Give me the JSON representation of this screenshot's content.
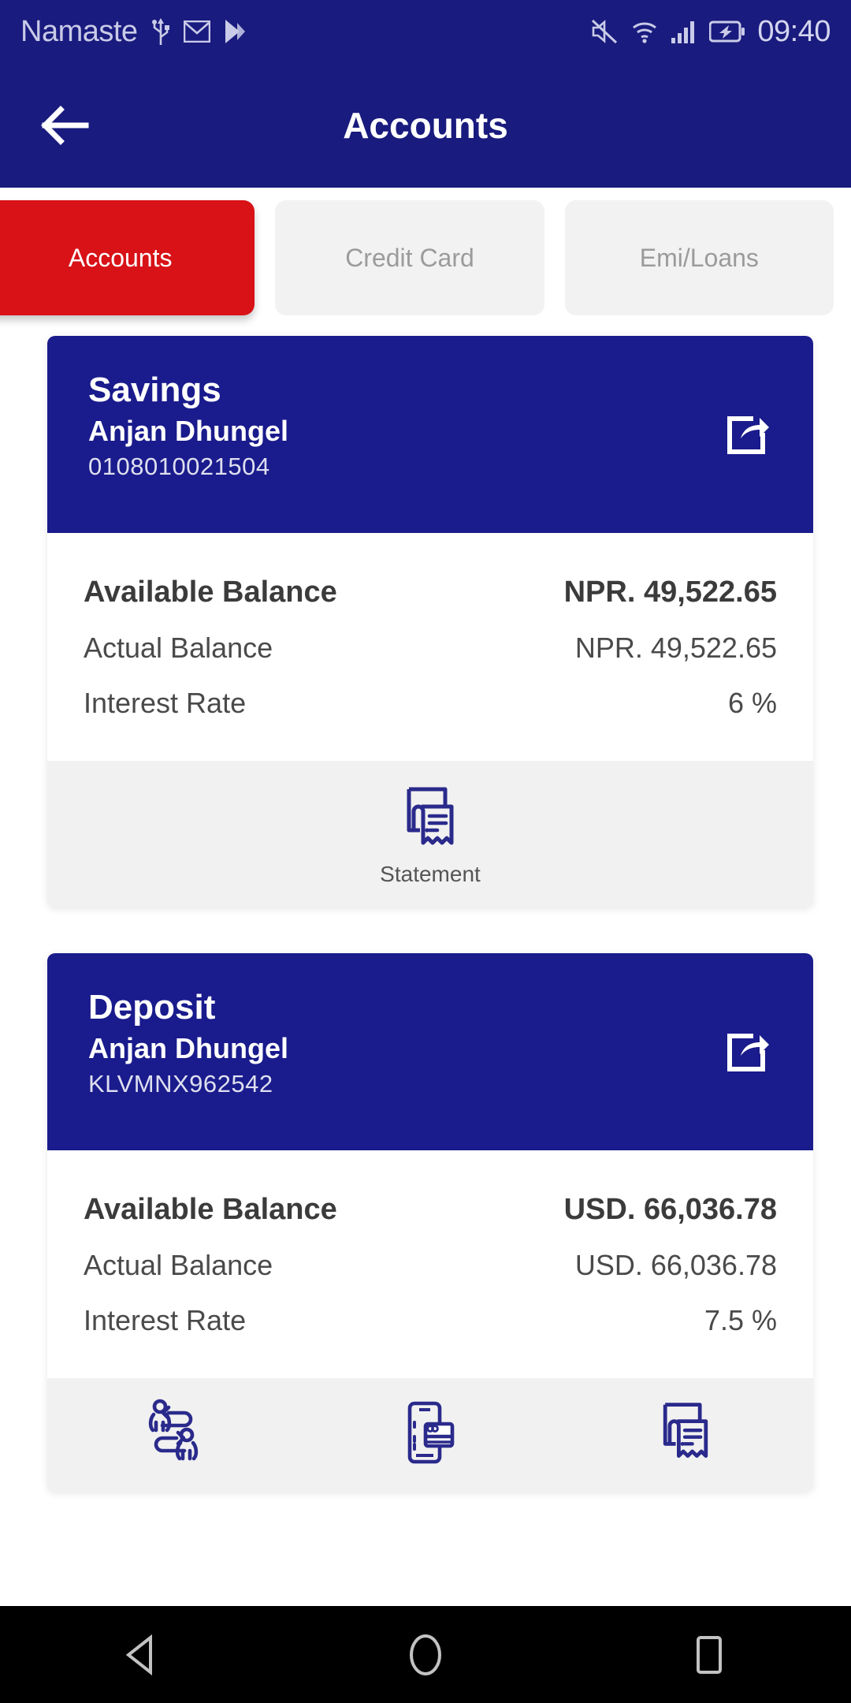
{
  "status_bar": {
    "carrier": "Namaste",
    "time": "09:40",
    "icons": [
      "usb-icon",
      "gmail-icon",
      "play-icon",
      "mute-icon",
      "wifi-icon",
      "signal-icon",
      "battery-charging-icon"
    ]
  },
  "app_bar": {
    "title": "Accounts",
    "back_icon": "arrow-left-icon"
  },
  "tabs": [
    {
      "label": "Accounts",
      "active": true
    },
    {
      "label": "Credit Card",
      "active": false
    },
    {
      "label": "Emi/Loans",
      "active": false
    }
  ],
  "accounts": [
    {
      "type": "Savings",
      "holder": "Anjan Dhungel",
      "number": "0108010021504",
      "share_icon": "share-icon",
      "rows": [
        {
          "label": "Available Balance",
          "value": "NPR. 49,522.65",
          "primary": true
        },
        {
          "label": "Actual Balance",
          "value": "NPR. 49,522.65",
          "primary": false
        },
        {
          "label": "Interest Rate",
          "value": "6 %",
          "primary": false
        }
      ],
      "actions": [
        {
          "icon": "statement-icon",
          "label": "Statement"
        }
      ]
    },
    {
      "type": "Deposit",
      "holder": "Anjan Dhungel",
      "number": "KLVMNX962542",
      "share_icon": "share-icon",
      "rows": [
        {
          "label": "Available Balance",
          "value": "USD. 66,036.78",
          "primary": true
        },
        {
          "label": "Actual Balance",
          "value": "USD. 66,036.78",
          "primary": false
        },
        {
          "label": "Interest Rate",
          "value": "7.5 %",
          "primary": false
        }
      ],
      "actions": [
        {
          "icon": "fund-transfer-icon",
          "label": ""
        },
        {
          "icon": "mobile-card-payment-icon",
          "label": ""
        },
        {
          "icon": "statement-icon",
          "label": ""
        }
      ]
    }
  ],
  "nav_bar": {
    "back": "triangle-back-icon",
    "home": "circle-home-icon",
    "recents": "square-recents-icon"
  },
  "colors": {
    "header_blue": "#1a1b7e",
    "card_blue": "#1a1b8c",
    "accent_red": "#d81217",
    "tab_inactive": "#f2f2f2",
    "icon_navy": "#2a2a8c"
  }
}
